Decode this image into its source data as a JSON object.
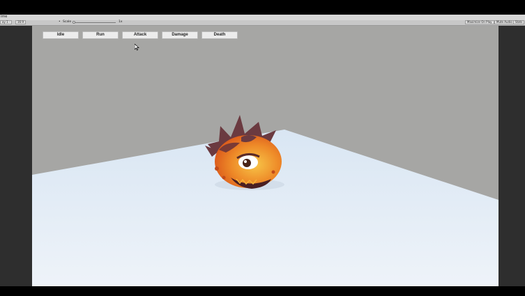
{
  "window": {
    "tab_title": "ime"
  },
  "toolbar": {
    "display_dropdown": "ay 1 ·",
    "aspect_dropdown": "16:9",
    "scale_label": "Scale",
    "scale_value": "1x",
    "maximize_on_play": "Maximize On Play",
    "mute_audio": "Mute Audio",
    "stats": "Stats"
  },
  "animation_buttons": [
    {
      "label": "Idle"
    },
    {
      "label": "Run"
    },
    {
      "label": "Attack"
    },
    {
      "label": "Damage"
    },
    {
      "label": "Death"
    }
  ],
  "colors": {
    "sky": "#a6a6a4",
    "floor_top": "#dce8f4",
    "floor_bottom": "#eef3f9",
    "creature_orange": "#e8701e",
    "creature_yellow": "#f5b53a",
    "spikes": "#6b3a40"
  },
  "icons": {
    "cursor": "mouse-pointer-icon"
  }
}
